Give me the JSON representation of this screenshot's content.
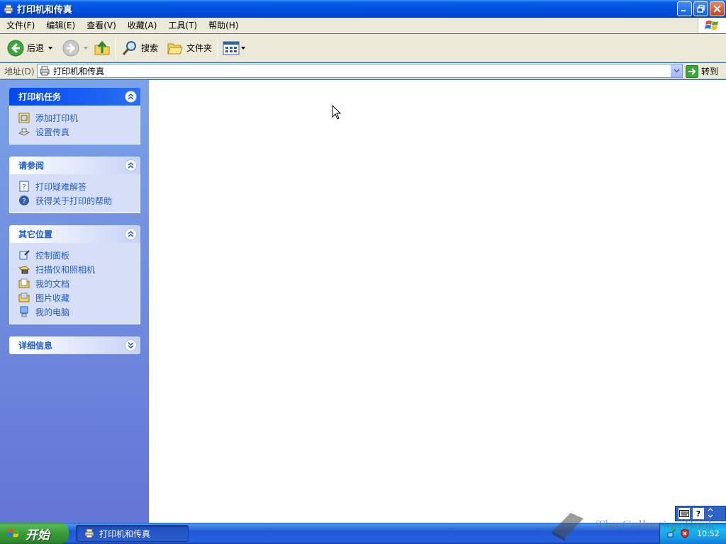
{
  "window": {
    "title": "打印机和传真"
  },
  "menu": [
    "文件(F)",
    "编辑(E)",
    "查看(V)",
    "收藏(A)",
    "工具(T)",
    "帮助(H)"
  ],
  "toolbar": {
    "back_label": "后退",
    "search_label": "搜索",
    "folders_label": "文件夹"
  },
  "address": {
    "label": "地址(D)",
    "value": "打印机和传真",
    "go_label": "转到"
  },
  "sidebar": {
    "printer_tasks": {
      "title": "打印机任务",
      "items": [
        "添加打印机",
        "设置传真"
      ]
    },
    "see_also": {
      "title": "请参阅",
      "items": [
        "打印疑难解答",
        "获得关于打印的帮助"
      ]
    },
    "other_places": {
      "title": "其它位置",
      "items": [
        "控制面板",
        "扫描仪和照相机",
        "我的文档",
        "图片收藏",
        "我的电脑"
      ]
    },
    "details": {
      "title": "详细信息"
    }
  },
  "taskbar": {
    "start_label": "开始",
    "task_label": "打印机和传真",
    "clock": "10:52"
  },
  "watermark": {
    "text": "The Collection Book"
  },
  "colors": {
    "titlebar": "#0050e0",
    "sidebar_top": "#7ba2e7",
    "sidebar_bottom": "#6375d6",
    "link": "#215dc6",
    "start": "#3a9a3a"
  }
}
